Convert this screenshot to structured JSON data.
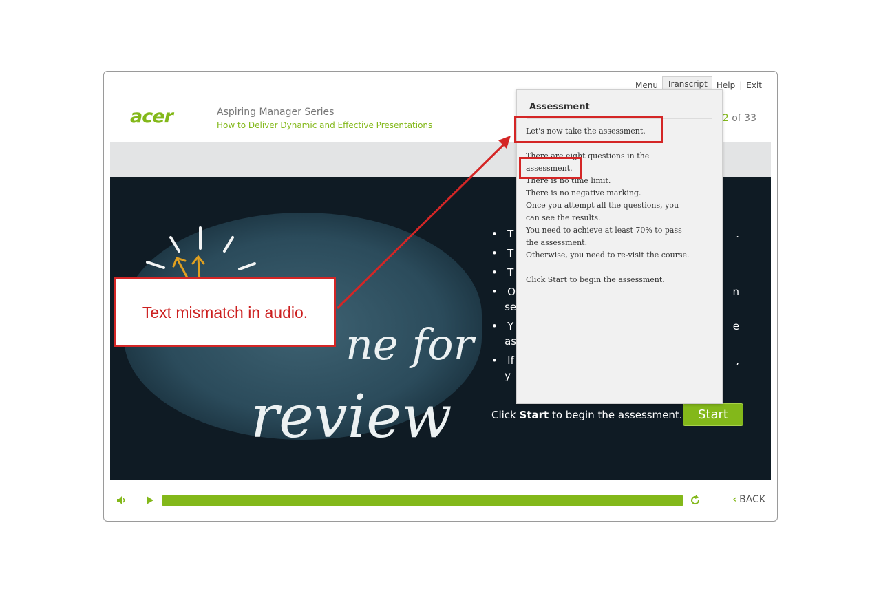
{
  "header": {
    "nav": [
      "Menu",
      "Transcript",
      "Help",
      "Exit"
    ],
    "logo": "acer",
    "series": "Aspiring Manager Series",
    "course": "How to Deliver Dynamic and Effective Presentations",
    "page_current": "2",
    "page_total_text": "of 33"
  },
  "slide": {
    "chalk_words": [
      "ne for",
      "review"
    ],
    "bullets_visible": [
      "T",
      "T",
      "T",
      "O",
      "se",
      "Y",
      "as",
      "If",
      "y"
    ],
    "bullets_right_fragments": [
      ".",
      "",
      "",
      "n",
      "",
      "e",
      "",
      ",",
      ""
    ],
    "click_prefix": "Click ",
    "click_bold": "Start",
    "click_suffix": " to begin the assessment.",
    "start_label": "Start"
  },
  "controls": {
    "back_label": "BACK",
    "progress": 1.0
  },
  "transcript": {
    "title": "Assessment",
    "lines": [
      "Let's now take the assessment.",
      "",
      "There are eight questions in the",
      "assessment.",
      "There is no time limit.",
      "There is no negative marking.",
      "Once you attempt all the questions, you",
      "can see the results.",
      "You need to achieve at least 70% to pass",
      "the assessment.",
      "Otherwise, you need to re-visit the course.",
      "",
      "Click Start to begin the assessment."
    ]
  },
  "annotation": {
    "callout_text": "Text mismatch in audio.",
    "color": "#d42626"
  },
  "colors": {
    "brand_green": "#83b81a",
    "stage_bg": "#0f1b24"
  }
}
